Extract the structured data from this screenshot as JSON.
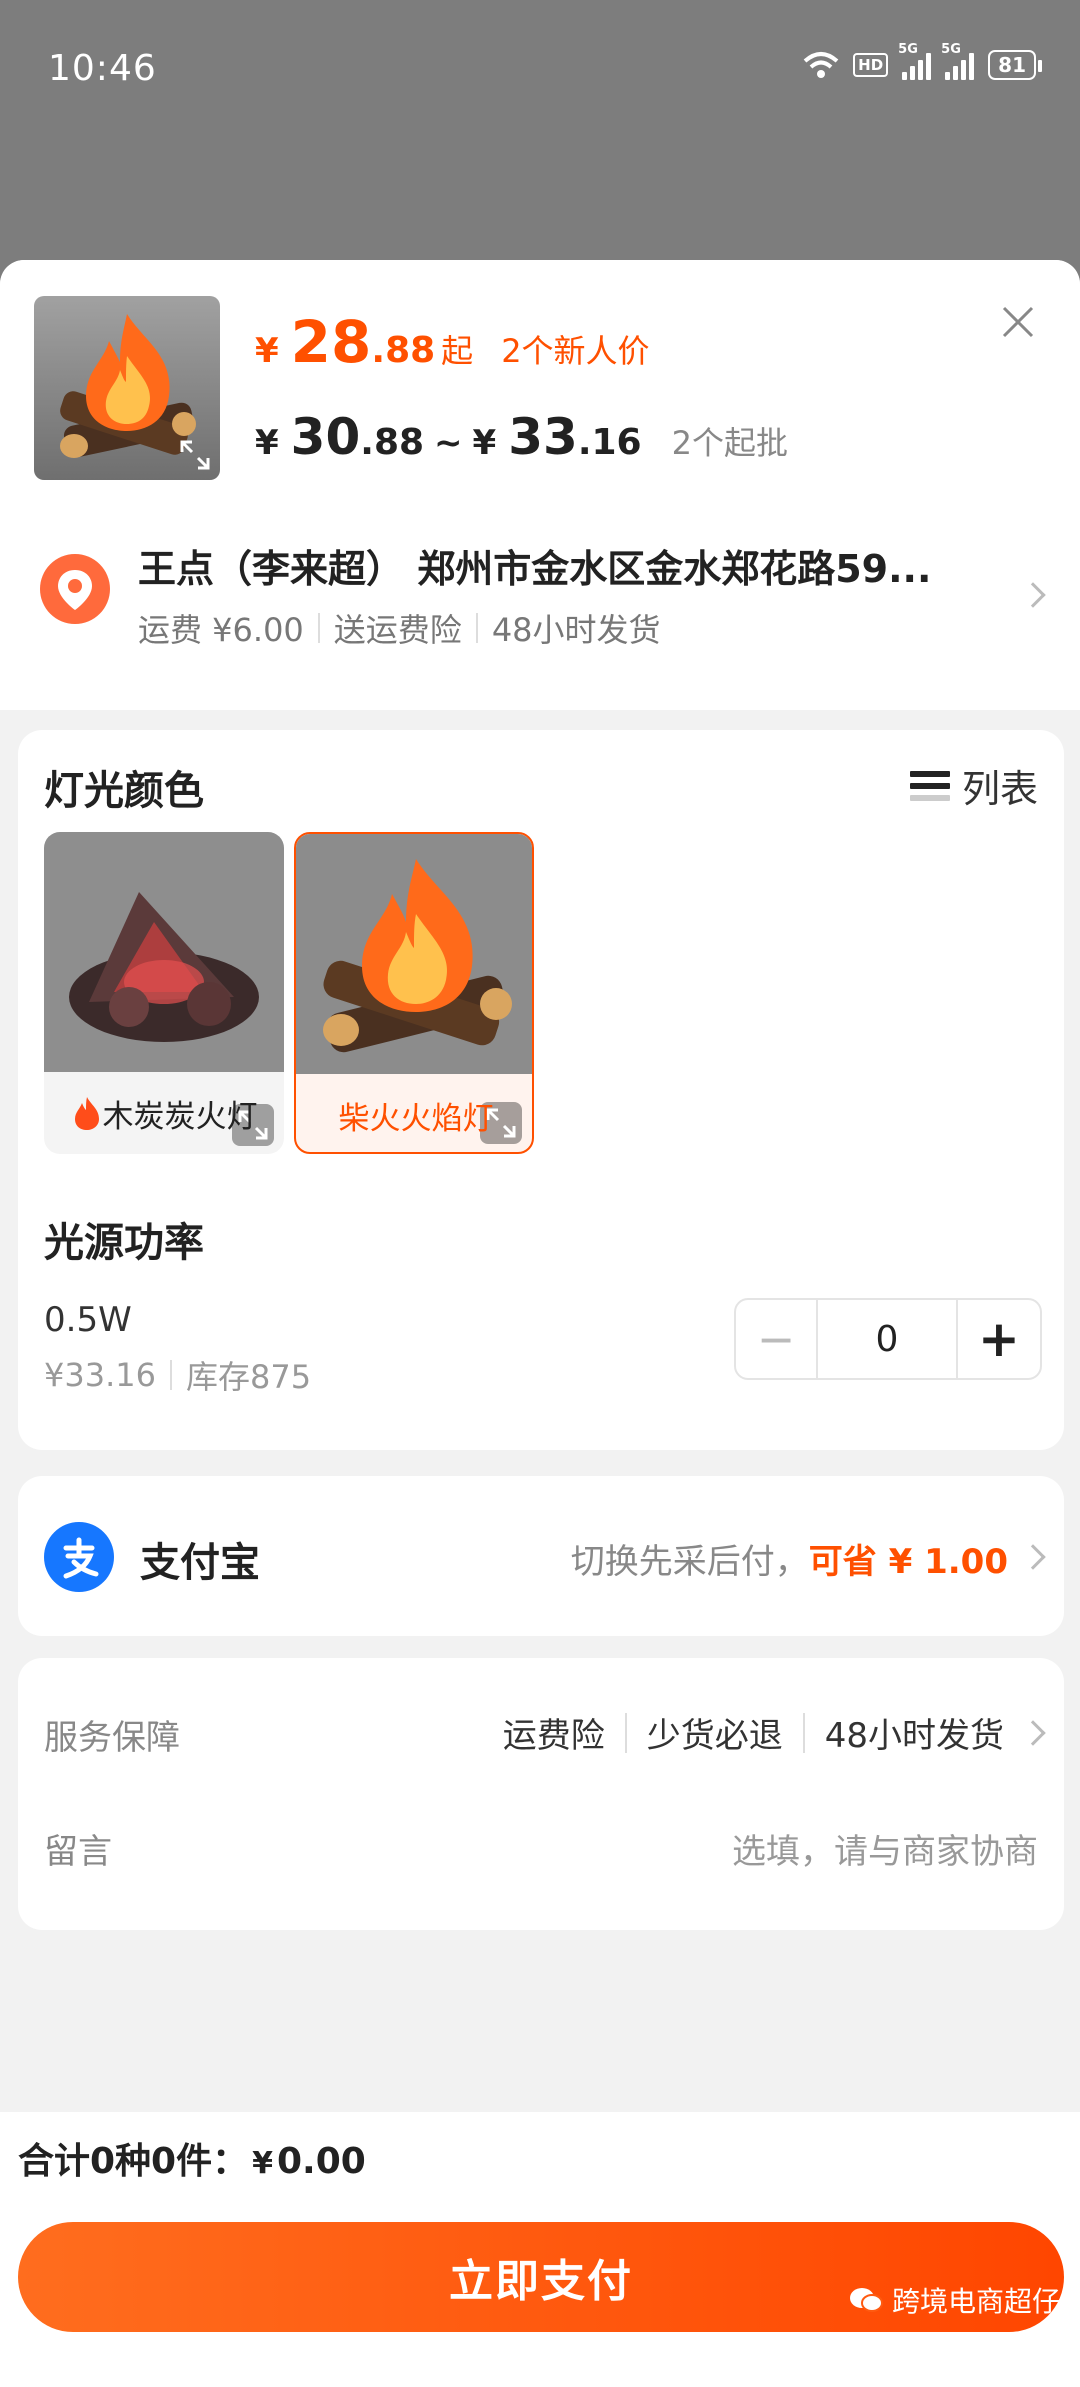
{
  "status_bar": {
    "time": "10:46",
    "hd": "HD",
    "sim1_label": "5G",
    "sim2_label": "5G",
    "battery": "81"
  },
  "product": {
    "price_new": {
      "currency": "¥",
      "integer": "28",
      "decimal": ".88",
      "suffix": "起",
      "tag": "2个新人价"
    },
    "price_range": {
      "low_currency": "¥",
      "low_integer": "30",
      "low_decimal": ".88",
      "sep": "~",
      "high_currency": "¥",
      "high_integer": "33",
      "high_decimal": ".16",
      "moq": "2个起批"
    }
  },
  "address": {
    "line1": "王点（李来超） 郑州市金水区金水郑花路59...",
    "shipping": "运费 ¥6.00",
    "insurance": "送运费险",
    "dispatch": "48小时发货"
  },
  "spec": {
    "color_title": "灯光颜色",
    "list_label": "列表",
    "options": [
      {
        "label": "木炭炭火灯",
        "selected": false
      },
      {
        "label": "柴火火焰灯",
        "selected": true
      }
    ],
    "power_title": "光源功率",
    "power_value": "0.5W",
    "power_price": "¥33.16",
    "power_stock": "库存875",
    "quantity": "0",
    "minus": "−",
    "plus": "+"
  },
  "payment": {
    "name": "支付宝",
    "switch_text": "切换先采后付，",
    "save_text": "可省 ¥ 1.00"
  },
  "service": {
    "label": "服务保障",
    "items": [
      "运费险",
      "少货必退",
      "48小时发货"
    ],
    "message_label": "留言",
    "message_placeholder": "选填，请与商家协商"
  },
  "footer": {
    "total_prefix": "合计0种0件：",
    "total_currency": "¥",
    "total_amount": "0.00",
    "pay_button": "立即支付",
    "watermark": "跨境电商超仔"
  },
  "colors": {
    "accent": "#ff5000",
    "alipay": "#1677ff",
    "location": "#ff6a3c"
  }
}
